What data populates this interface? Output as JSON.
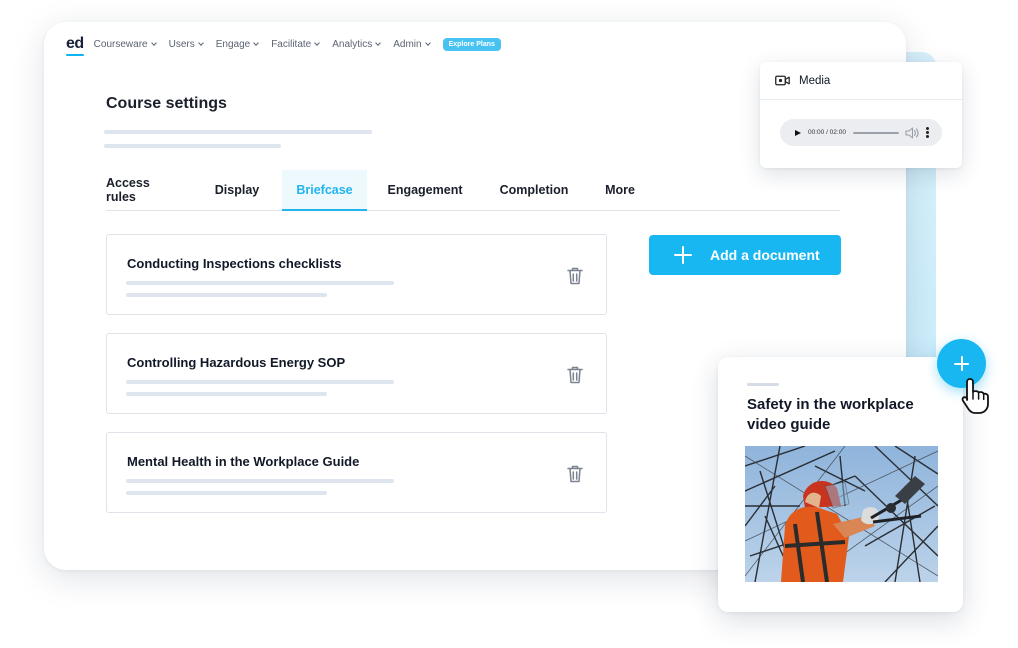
{
  "nav": {
    "logo": "ed",
    "items": [
      {
        "label": "Courseware"
      },
      {
        "label": "Users"
      },
      {
        "label": "Engage"
      },
      {
        "label": "Facilitate"
      },
      {
        "label": "Analytics"
      },
      {
        "label": "Admin"
      }
    ],
    "explore_label": "Explore Plans"
  },
  "page": {
    "title": "Course settings"
  },
  "tabs": [
    {
      "label": "Access rules"
    },
    {
      "label": "Display"
    },
    {
      "label": "Briefcase",
      "active": true
    },
    {
      "label": "Engagement"
    },
    {
      "label": "Completion"
    },
    {
      "label": "More"
    }
  ],
  "documents": [
    {
      "title": "Conducting Inspections checklists",
      "icon": "trash-icon"
    },
    {
      "title": "Controlling Hazardous Energy SOP",
      "icon": "trash-icon"
    },
    {
      "title": "Mental Health in the Workplace Guide",
      "icon": "trash-icon"
    }
  ],
  "add_document": {
    "label": "Add a document",
    "icon": "plus-icon"
  },
  "media": {
    "title": "Media",
    "icon": "video-camera-icon",
    "player": {
      "time": "00:00 / 02:00",
      "icons": [
        "play-icon",
        "volume-icon",
        "more-vertical-icon"
      ]
    }
  },
  "video_card": {
    "title": "Safety in the workplace video guide",
    "thumbnail": "worker-photo"
  },
  "fab": {
    "icon": "plus-icon"
  },
  "colors": {
    "accent": "#18b7f2",
    "tab_active": "#22b4ee",
    "tab_active_bg": "#eef9fe",
    "text": "#1a1f2b",
    "skeleton": "#dfe5ee"
  }
}
